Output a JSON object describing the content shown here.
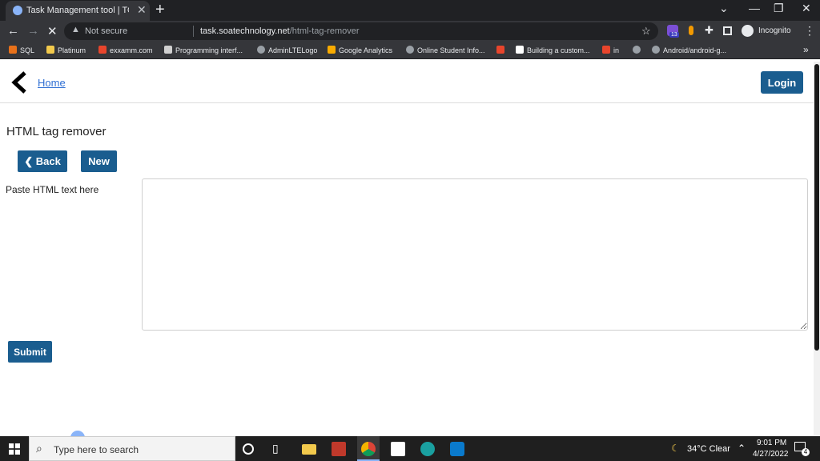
{
  "browser": {
    "tab_title": "Task Management tool | TO-DO l",
    "tab_close": "✕",
    "new_tab": "+",
    "window_controls": {
      "minimize": "⌄",
      "restore": "—",
      "maximize": "❐",
      "close": "✕"
    },
    "nav": {
      "back": "←",
      "forward": "→",
      "stop": "✕"
    },
    "address": {
      "security": "Not secure",
      "domain": "task.soatechnology.net",
      "path": "/html-tag-remover"
    },
    "badge_count": "13",
    "profile": "Incognito",
    "bookmarks": [
      {
        "label": "SQL",
        "color": "#e8711a"
      },
      {
        "label": "Platinum",
        "color": "#f2c94c"
      },
      {
        "label": "exxamm.com",
        "color": "#e8452c"
      },
      {
        "label": "Programming interf...",
        "color": "#d0d0d0"
      },
      {
        "label": "AdminLTELogo",
        "color": "#9aa0a6"
      },
      {
        "label": "Google Analytics",
        "color": "#f9ab00"
      },
      {
        "label": "Online Student Info...",
        "color": "#9aa0a6"
      },
      {
        "label": "",
        "color": "#e8452c"
      },
      {
        "label": "Building a custom...",
        "color": "#ffffff"
      },
      {
        "label": "in",
        "color": "#e8452c"
      },
      {
        "label": "",
        "color": "#9aa0a6"
      },
      {
        "label": "Android/android-g...",
        "color": "#9aa0a6"
      }
    ],
    "bookmarks_overflow": "»"
  },
  "page": {
    "home_link": "Home",
    "login_button": "Login",
    "title": "HTML tag remover",
    "back_button": "Back",
    "new_button": "New",
    "paste_label": "Paste HTML text here",
    "html_input_value": "",
    "submit_button": "Submit",
    "accent_color": "#1a5d8f"
  },
  "taskbar": {
    "search_placeholder": "Type here to search",
    "weather": "34°C  Clear",
    "time": "9:01 PM",
    "date": "4/27/2022",
    "notifications": "4"
  }
}
